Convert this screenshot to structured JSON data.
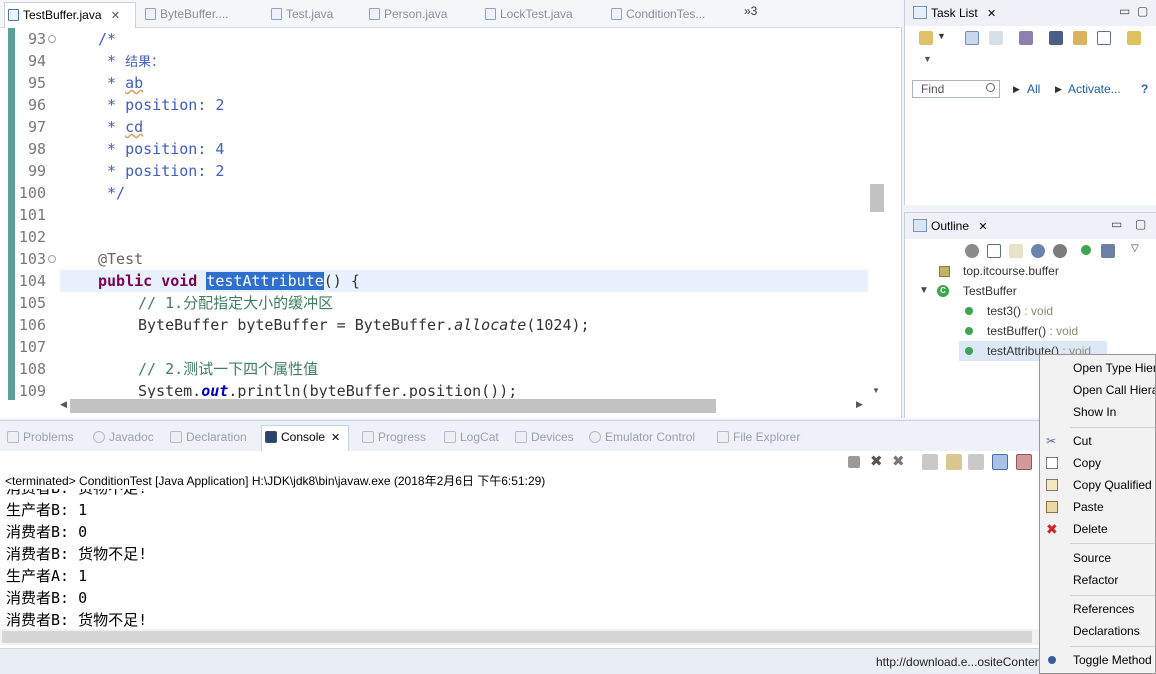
{
  "editor": {
    "tabs": [
      {
        "label": "TestBuffer.java",
        "active": true,
        "close": "✕"
      },
      {
        "label": "ByteBuffer....",
        "active": false
      },
      {
        "label": "Test.java",
        "active": false
      },
      {
        "label": "Person.java",
        "active": false
      },
      {
        "label": "LockTest.java",
        "active": false
      },
      {
        "label": "ConditionTes...",
        "active": false
      }
    ],
    "overflow_label": "»3",
    "line_numbers": [
      "93",
      "94",
      "95",
      "96",
      "97",
      "98",
      "99",
      "100",
      "101",
      "102",
      "103",
      "104",
      "105",
      "106",
      "107",
      "108",
      "109"
    ],
    "code": {
      "l93": "/*",
      "l94_star": " * ",
      "l94_text": "结果：",
      "l95_star": " * ",
      "l95_text": "ab",
      "l96": " * position: 2",
      "l97_star": " * ",
      "l97_text": "cd",
      "l98": " * position: 4",
      "l99": " * position: 2",
      "l100": " */",
      "l103": "@Test",
      "l104_kw1": "public",
      "l104_kw2": "void",
      "l104_name": "testAttribute",
      "l104_rest": "() {",
      "l105": "// 1.分配指定大小的缓冲区",
      "l106_a": "ByteBuffer byteBuffer = ByteBuffer.",
      "l106_b": "allocate",
      "l106_c": "(1024);",
      "l108": "// 2.测试一下四个属性值",
      "l109_a": "System.",
      "l109_b": "out",
      "l109_c": ".println(byteBuffer.position());"
    }
  },
  "tasklist": {
    "title": "Task List",
    "find_placeholder": "Find",
    "all_label": "All",
    "activate_label": "Activate...",
    "help_label": "?"
  },
  "outline": {
    "title": "Outline",
    "package": "top.itcourse.buffer",
    "class_name": "TestBuffer",
    "methods": [
      {
        "name": "test3()",
        "type": " : void"
      },
      {
        "name": "testBuffer()",
        "type": " : void"
      },
      {
        "name": "testAttribute()",
        "type": " : void"
      }
    ]
  },
  "console": {
    "tabs": [
      {
        "label": "Problems"
      },
      {
        "label": "Javadoc"
      },
      {
        "label": "Declaration"
      },
      {
        "label": "Console",
        "active": true
      },
      {
        "label": "Progress"
      },
      {
        "label": "LogCat"
      },
      {
        "label": "Devices"
      },
      {
        "label": "Emulator Control"
      },
      {
        "label": "File Explorer"
      }
    ],
    "terminated": "<terminated> ConditionTest [Java Application] H:\\JDK\\jdk8\\bin\\javaw.exe (2018年2月6日 下午6:51:29)",
    "output": [
      "消费者B: 货物不足!",
      "生产者B: 1",
      "消费者B: 0",
      "消费者B: 货物不足!",
      "生产者A: 1",
      "消费者B: 0",
      "消费者B: 货物不足!"
    ]
  },
  "context_menu": {
    "items": [
      {
        "label": "Open Type Hierarchy",
        "icon": "none"
      },
      {
        "label": "Open Call Hierarchy",
        "icon": "none"
      },
      {
        "label": "Show In",
        "icon": "none"
      },
      {
        "label": "Cut",
        "icon": "scissors-icon"
      },
      {
        "label": "Copy",
        "icon": "copy-icon"
      },
      {
        "label": "Copy Qualified Name",
        "icon": "copy-qualified-icon"
      },
      {
        "label": "Paste",
        "icon": "paste-icon"
      },
      {
        "label": "Delete",
        "icon": "delete-icon"
      },
      {
        "label": "Source",
        "icon": "none"
      },
      {
        "label": "Refactor",
        "icon": "none"
      },
      {
        "label": "References",
        "icon": "none"
      },
      {
        "label": "Declarations",
        "icon": "none"
      },
      {
        "label": "Toggle Method Breakpoint",
        "icon": "breakpoint-icon"
      }
    ]
  },
  "statusbar": {
    "url": "http://download.e...ositeContent.jar"
  },
  "colors": {
    "keyword": "#7f0055",
    "comment": "#3f7f5f",
    "javadoc": "#3f5fbf",
    "selection": "#2f6fcf",
    "static_field": "#0000c0",
    "method_green": "#3aa64d"
  }
}
